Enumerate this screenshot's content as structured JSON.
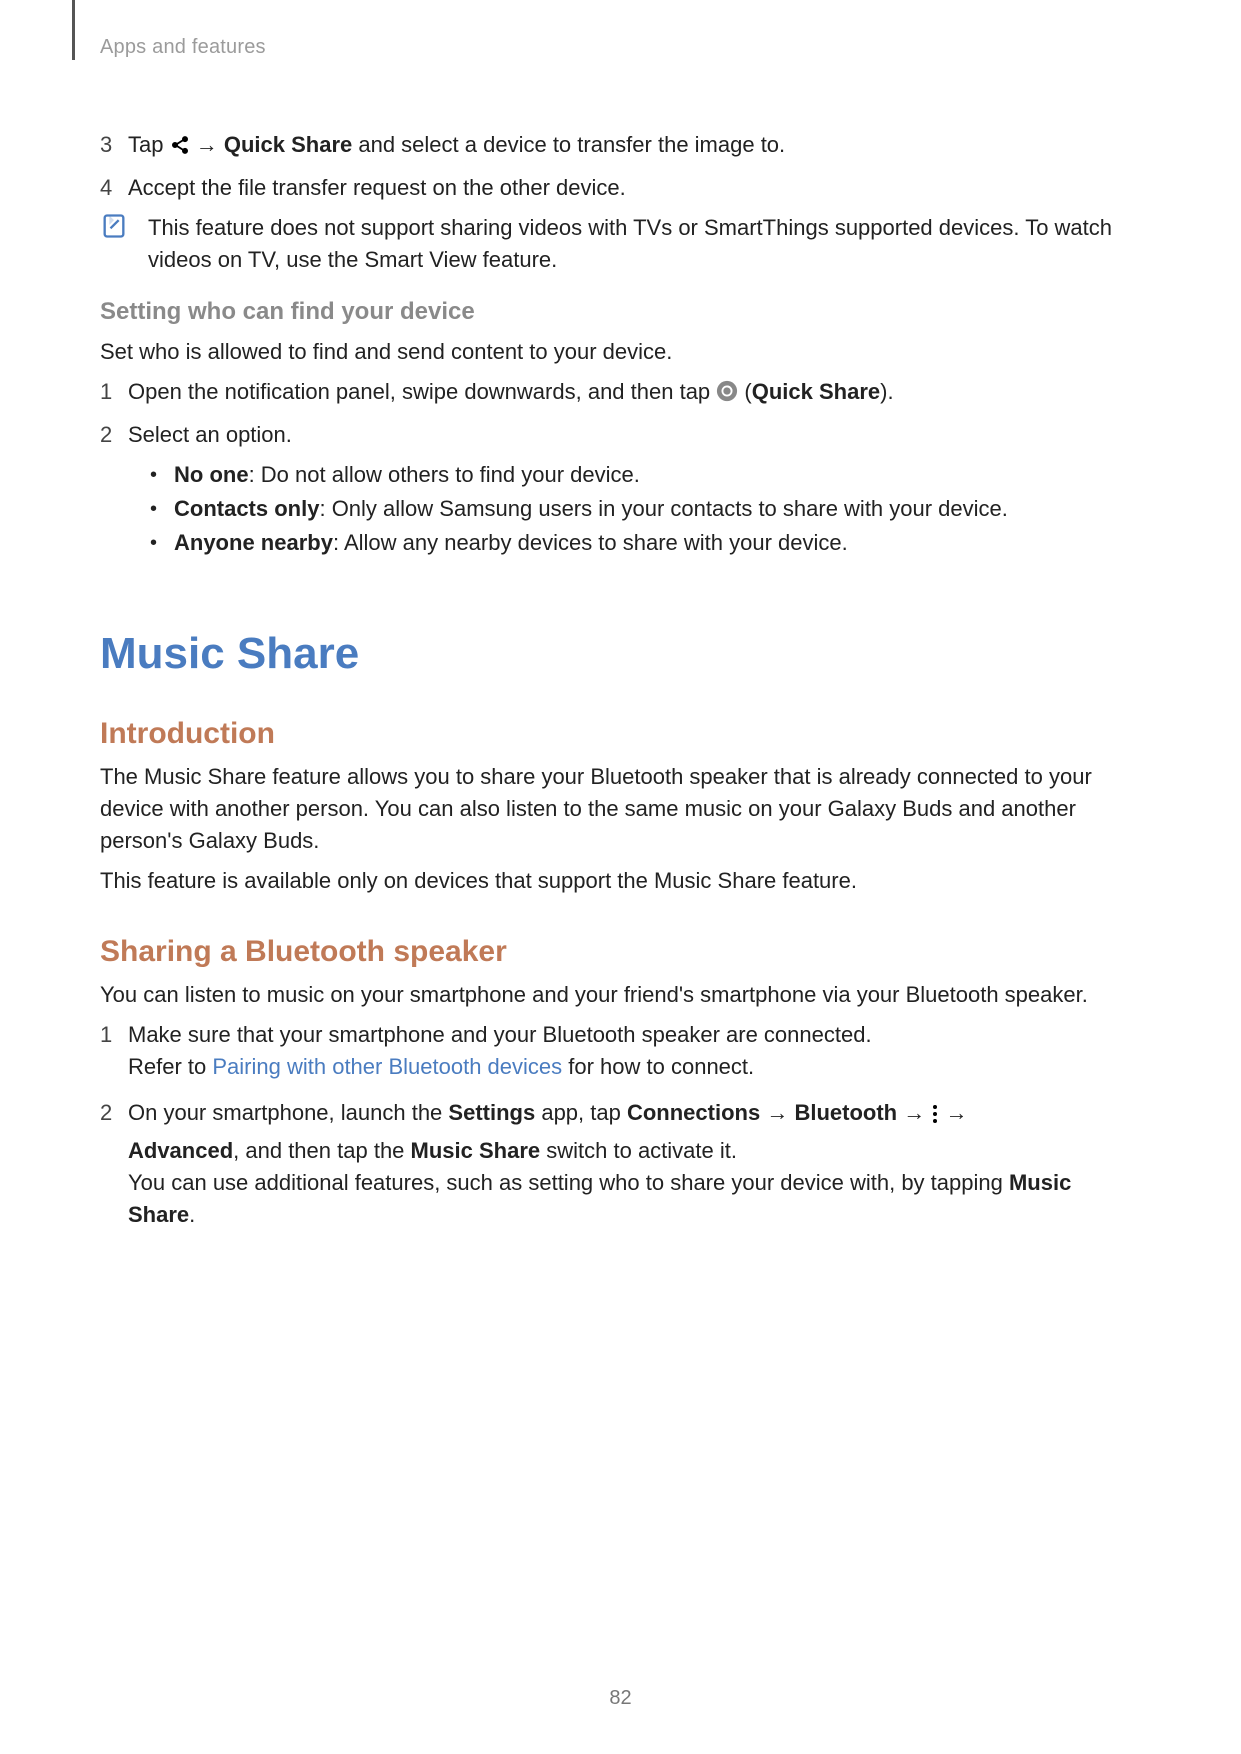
{
  "breadcrumb": "Apps and features",
  "section_a": {
    "step3": {
      "num": "3",
      "pre": "Tap ",
      "arrow": " → ",
      "bold": "Quick Share",
      "post": " and select a device to transfer the image to."
    },
    "step4": {
      "num": "4",
      "text": "Accept the file transfer request on the other device."
    },
    "note": "This feature does not support sharing videos with TVs or SmartThings supported devices. To watch videos on TV, use the Smart View feature."
  },
  "setting": {
    "heading": "Setting who can find your device",
    "para": "Set who is allowed to find and send content to your device.",
    "step1": {
      "num": "1",
      "pre": "Open the notification panel, swipe downwards, and then tap ",
      "open_paren": " (",
      "bold": "Quick Share",
      "close": ")."
    },
    "step2": {
      "num": "2",
      "text": "Select an option."
    },
    "bullet1": {
      "bold": "No one",
      "rest": ": Do not allow others to find your device."
    },
    "bullet2": {
      "bold": "Contacts only",
      "rest": ": Only allow Samsung users in your contacts to share with your device."
    },
    "bullet3": {
      "bold": "Anyone nearby",
      "rest": ": Allow any nearby devices to share with your device."
    }
  },
  "music_share": {
    "title": "Music Share",
    "intro_h": "Introduction",
    "intro_p1": "The Music Share feature allows you to share your Bluetooth speaker that is already connected to your device with another person. You can also listen to the same music on your Galaxy Buds and another person's Galaxy Buds.",
    "intro_p2": "This feature is available only on devices that support the Music Share feature.",
    "share_h": "Sharing a Bluetooth speaker",
    "share_p": "You can listen to music on your smartphone and your friend's smartphone via your Bluetooth speaker.",
    "step1": {
      "num": "1",
      "line1": "Make sure that your smartphone and your Bluetooth speaker are connected.",
      "line2_pre": "Refer to ",
      "line2_link": "Pairing with other Bluetooth devices",
      "line2_post": " for how to connect."
    },
    "step2": {
      "num": "2",
      "l1_a": "On your smartphone, launch the ",
      "l1_b": "Settings",
      "l1_c": " app, tap ",
      "l1_d": "Connections",
      "l1_e": " → ",
      "l1_f": "Bluetooth",
      "l1_g": " → ",
      "l1_h": " → ",
      "l2_a": "Advanced",
      "l2_b": ", and then tap the ",
      "l2_c": "Music Share",
      "l2_d": " switch to activate it.",
      "l3": "You can use additional features, such as setting who to share your device with, by tapping ",
      "l3_bold": "Music Share",
      "l3_end": "."
    }
  },
  "page_number": "82"
}
